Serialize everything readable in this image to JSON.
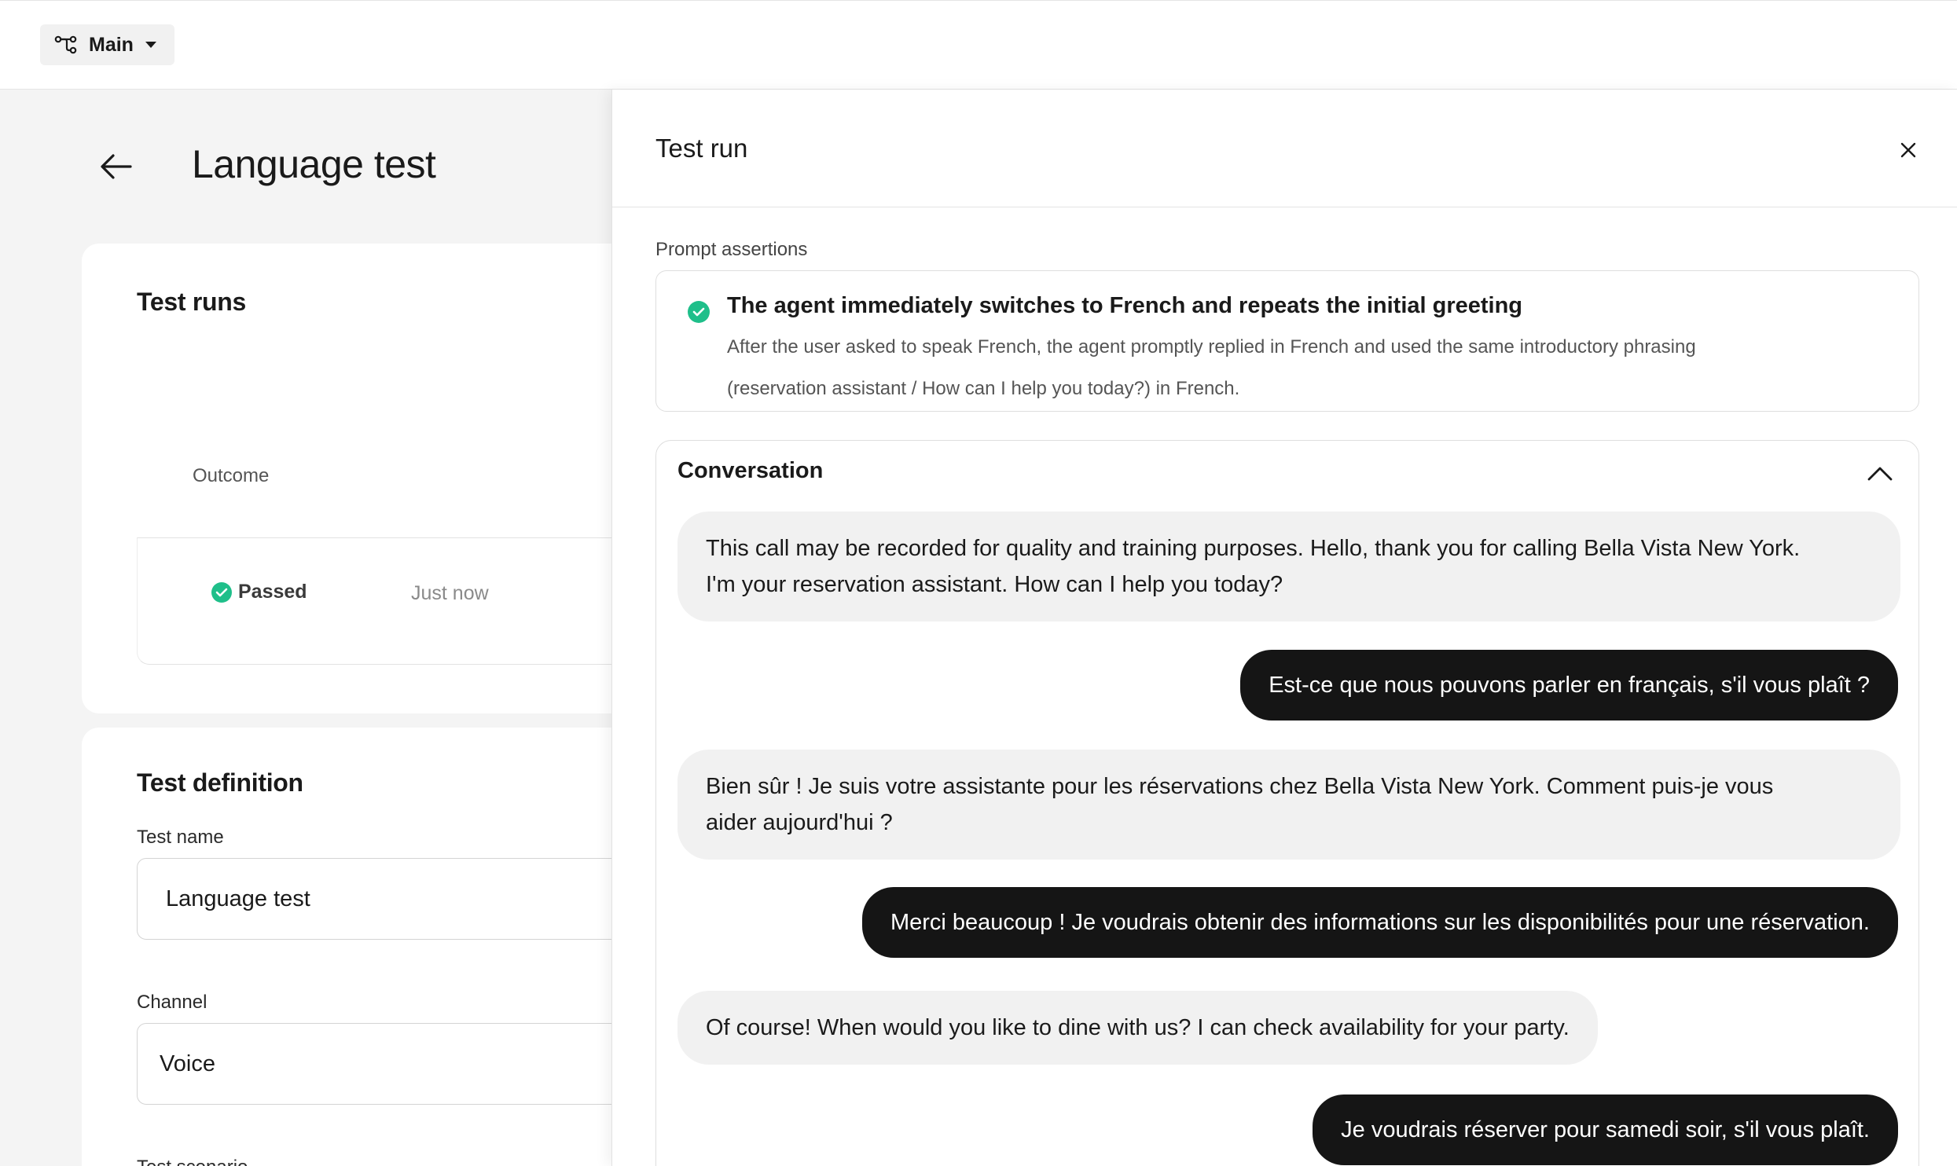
{
  "topbar": {
    "branch_label": "Main"
  },
  "page": {
    "title": "Language test"
  },
  "test_runs": {
    "heading": "Test runs",
    "column_outcome": "Outcome",
    "rows": [
      {
        "status": "Passed",
        "time": "Just now"
      }
    ]
  },
  "test_definition": {
    "heading": "Test definition",
    "test_name_label": "Test name",
    "test_name_value": "Language test",
    "channel_label": "Channel",
    "channel_value": "Voice",
    "scenario_label": "Test scenario"
  },
  "panel": {
    "title": "Test run",
    "prompt_assertions_label": "Prompt assertions",
    "assertion": {
      "title": "The agent immediately switches to French and repeats the initial greeting",
      "description_line1": "After the user asked to speak French, the agent promptly replied in French and used the same introductory phrasing",
      "description_line2": "(reservation assistant / How can I help you today?) in French."
    },
    "conversation_label": "Conversation",
    "messages": [
      {
        "role": "agent",
        "line1": "This call may be recorded for quality and training purposes. Hello, thank you for calling Bella Vista New York.",
        "line2": "I'm your reservation assistant. How can I help you today?"
      },
      {
        "role": "user",
        "line1": "Est-ce que nous pouvons parler en français, s'il vous plaît ?"
      },
      {
        "role": "agent",
        "line1": "Bien sûr ! Je suis votre assistante pour les réservations chez Bella Vista New York. Comment puis-je vous",
        "line2": "aider aujourd'hui ?"
      },
      {
        "role": "user",
        "line1": "Merci beaucoup ! Je voudrais obtenir des informations sur les disponibilités pour une réservation."
      },
      {
        "role": "agent",
        "line1": "Of course! When would you like to dine with us? I can check availability for your party."
      },
      {
        "role": "user",
        "line1": "Je voudrais réserver pour samedi soir, s'il vous plaît."
      }
    ]
  },
  "colors": {
    "success": "#1fbf8a",
    "user_bubble": "#151515",
    "agent_bubble": "#f1f1f1"
  },
  "icons": {
    "branch": "branch-icon",
    "dropdown": "caret-down-icon",
    "back": "arrow-left-icon",
    "close": "close-icon",
    "check": "check-circle-icon",
    "collapse": "chevron-up-icon"
  }
}
